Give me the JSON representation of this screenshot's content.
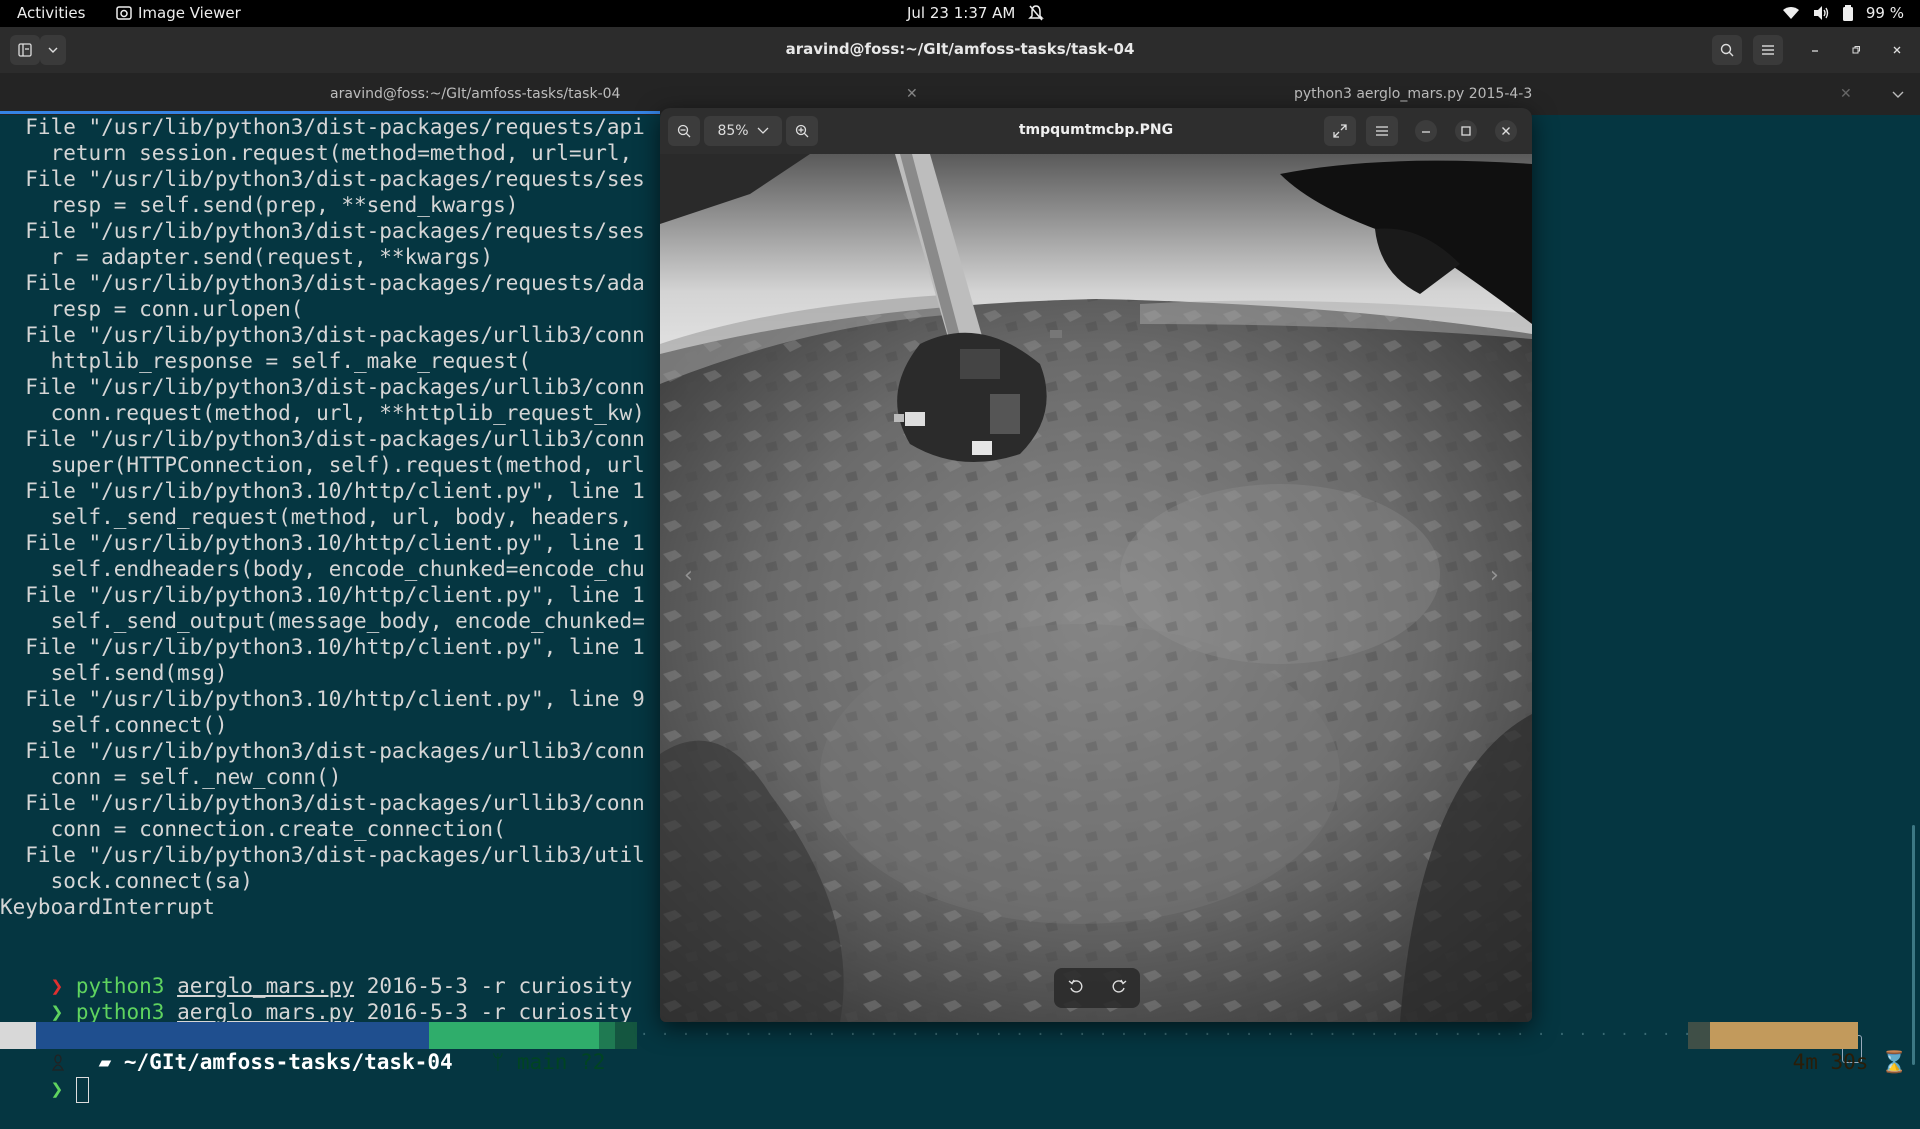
{
  "topbar": {
    "activities": "Activities",
    "app_name": "Image Viewer",
    "clock": "Jul 23  1:37 AM",
    "battery": "99 %"
  },
  "terminal": {
    "title": "aravind@foss:~/GIt/amfoss-tasks/task-04",
    "tabs": [
      {
        "label": "aravind@foss:~/GIt/amfoss-tasks/task-04"
      },
      {
        "label": "python3 aerglo_mars.py 2015-4-3"
      }
    ],
    "lines": [
      "  File \"/usr/lib/python3/dist-packages/requests/api",
      "    return session.request(method=method, url=url, ",
      "  File \"/usr/lib/python3/dist-packages/requests/ses",
      "    resp = self.send(prep, **send_kwargs)",
      "  File \"/usr/lib/python3/dist-packages/requests/ses",
      "    r = adapter.send(request, **kwargs)",
      "  File \"/usr/lib/python3/dist-packages/requests/ada",
      "    resp = conn.urlopen(",
      "  File \"/usr/lib/python3/dist-packages/urllib3/conn",
      "    httplib_response = self._make_request(",
      "  File \"/usr/lib/python3/dist-packages/urllib3/conn",
      "    conn.request(method, url, **httplib_request_kw)",
      "  File \"/usr/lib/python3/dist-packages/urllib3/conn",
      "    super(HTTPConnection, self).request(method, url",
      "  File \"/usr/lib/python3.10/http/client.py\", line 1",
      "    self._send_request(method, url, body, headers, ",
      "  File \"/usr/lib/python3.10/http/client.py\", line 1",
      "    self.endheaders(body, encode_chunked=encode_chu",
      "  File \"/usr/lib/python3.10/http/client.py\", line 1",
      "    self._send_output(message_body, encode_chunked=",
      "  File \"/usr/lib/python3.10/http/client.py\", line 1",
      "    self.send(msg)",
      "  File \"/usr/lib/python3.10/http/client.py\", line 9",
      "    self.connect()",
      "  File \"/usr/lib/python3/dist-packages/urllib3/conn",
      "    conn = self._new_conn()",
      "  File \"/usr/lib/python3/dist-packages/urllib3/conn",
      "    conn = connection.create_connection(",
      "  File \"/usr/lib/python3/dist-packages/urllib3/util",
      "    sock.connect(sa)",
      "KeyboardInterrupt"
    ],
    "commands": [
      {
        "symbol": "❯",
        "cmd": "python3",
        "file": "aerglo_mars.py",
        "args": "2016-5-3 -r curiosity"
      },
      {
        "symbol": "❯",
        "cmd": "python3",
        "file": "aerglo_mars.py",
        "args": "2016-5-3 -r curiosity"
      }
    ],
    "powerline": {
      "path": "~/GIt/amfoss-tasks/task-04",
      "branch": "main ?2",
      "duration": "4m 30s"
    },
    "prompt_symbol": "❯"
  },
  "viewer": {
    "zoom": "85%",
    "filename": "tmpqumtmcbp.PNG"
  }
}
